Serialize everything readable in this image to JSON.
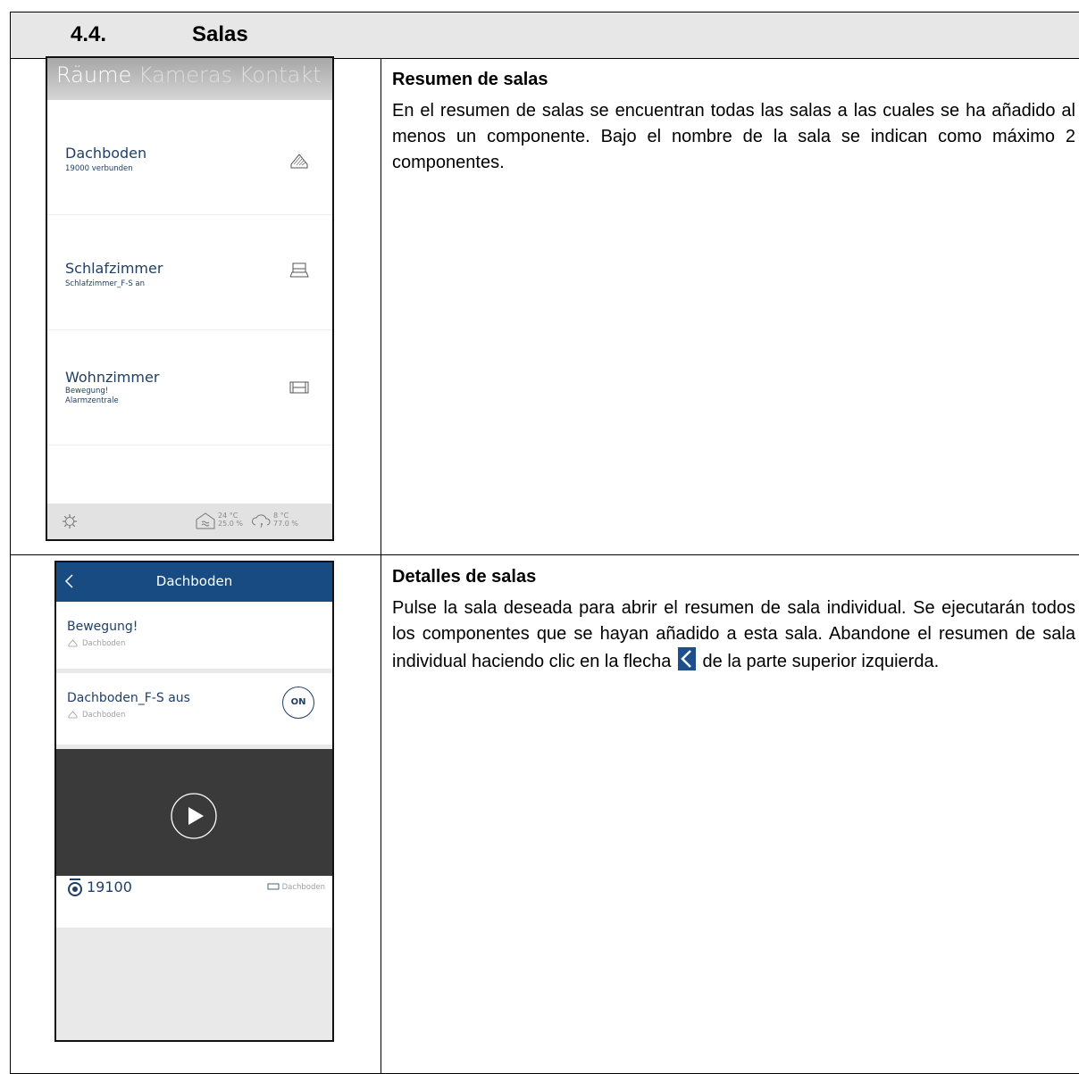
{
  "section": {
    "number": "4.4.",
    "title": "Salas"
  },
  "overview": {
    "heading": "Resumen de salas",
    "body": "En el resumen de salas se encuentran todas las salas a las cuales se ha añadido al menos un componente. Bajo el nombre de la sala se indican como máximo 2 componentes."
  },
  "details": {
    "heading": "Detalles de salas",
    "body_before": "Pulse la sala deseada para abrir el resumen de sala individual. Se ejecutarán todos los componentes que se hayan añadido a esta sala. Abandone el resumen de sala individual haciendo clic en la flecha",
    "body_after": "de la parte superior izquierda."
  },
  "phone1": {
    "tabs": [
      "Räume",
      "Kameras",
      "Kontakt"
    ],
    "rooms": [
      {
        "name": "Dachboden",
        "sub1": "19000 verbunden",
        "sub2": "",
        "icon": "roof-icon"
      },
      {
        "name": "Schlafzimmer",
        "sub1": "Schlafzimmer_F-S an",
        "sub2": "",
        "icon": "bed-icon"
      },
      {
        "name": "Wohnzimmer",
        "sub1": "Bewegung!",
        "sub2": "Alarmzentrale",
        "icon": "sofa-icon"
      }
    ],
    "footer": {
      "indoor_temp": "24 °C",
      "indoor_humidity": "25.0 %",
      "outdoor_temp": "8 °C",
      "outdoor_humidity": "77.0 %"
    }
  },
  "phone2": {
    "title": "Dachboden",
    "items": [
      {
        "title": "Bewegung!",
        "room": "Dachboden"
      },
      {
        "title": "Dachboden_F-S aus",
        "room": "Dachboden",
        "button": "ON"
      }
    ],
    "camera": {
      "name": "19100",
      "room": "Dachboden"
    }
  },
  "colors": {
    "accent": "#174b82",
    "room_text": "#1f3f66"
  }
}
